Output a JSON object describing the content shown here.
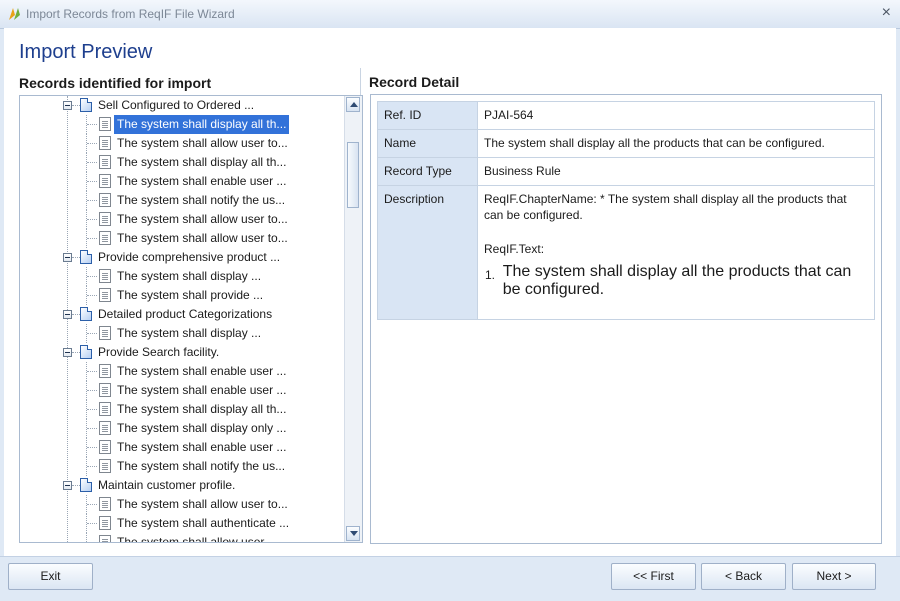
{
  "window": {
    "title": "Import Records from ReqIF File Wizard",
    "close_glyph": "×"
  },
  "page": {
    "title": "Import Preview"
  },
  "left_panel": {
    "title": "Records identified for import"
  },
  "tree": {
    "items": [
      {
        "level": 1,
        "label": "Sell Configured to Ordered ..."
      },
      {
        "level": 2,
        "label": "The system shall display all th...",
        "selected": true
      },
      {
        "level": 2,
        "label": "The system shall allow user to..."
      },
      {
        "level": 2,
        "label": "The system shall display all th..."
      },
      {
        "level": 2,
        "label": "The system shall enable user ..."
      },
      {
        "level": 2,
        "label": "The system shall notify the us..."
      },
      {
        "level": 2,
        "label": "The system shall allow user to..."
      },
      {
        "level": 2,
        "label": "The system shall allow user to..."
      },
      {
        "level": 1,
        "label": "Provide comprehensive product ..."
      },
      {
        "level": 2,
        "label": "The system shall display ..."
      },
      {
        "level": 2,
        "label": "The system shall provide ..."
      },
      {
        "level": 1,
        "label": "Detailed product Categorizations"
      },
      {
        "level": 2,
        "label": "The system shall display ..."
      },
      {
        "level": 1,
        "label": "Provide Search facility."
      },
      {
        "level": 2,
        "label": "The system shall enable user ..."
      },
      {
        "level": 2,
        "label": "The system shall enable user ..."
      },
      {
        "level": 2,
        "label": "The system shall display all th..."
      },
      {
        "level": 2,
        "label": "The system shall display only ..."
      },
      {
        "level": 2,
        "label": "The system shall enable user ..."
      },
      {
        "level": 2,
        "label": "The system shall notify the us..."
      },
      {
        "level": 1,
        "label": "Maintain customer profile."
      },
      {
        "level": 2,
        "label": "The system shall allow user to..."
      },
      {
        "level": 2,
        "label": "The system shall authenticate ..."
      },
      {
        "level": 2,
        "label": "The system shall allow user ..."
      }
    ]
  },
  "detail": {
    "title": "Record Detail",
    "ref_id_label": "Ref. ID",
    "ref_id": "PJAI-564",
    "name_label": "Name",
    "name": "The system shall display all the products that can be configured.",
    "record_type_label": "Record Type",
    "record_type": "Business Rule",
    "description_label": "Description",
    "description_chapter": "ReqIF.ChapterName: * The system shall display all the products that can be configured.",
    "description_text_label": "ReqIF.Text:",
    "description_list_num": "1.",
    "description_list_item": "The system shall display all the products that can be configured."
  },
  "footer": {
    "exit": "Exit",
    "first": "<< First",
    "back": "< Back",
    "next": "Next >"
  },
  "colors": {
    "accent": "#3272d9",
    "title_blue": "#1e3f8e",
    "key_cell": "#d9e5f4"
  }
}
